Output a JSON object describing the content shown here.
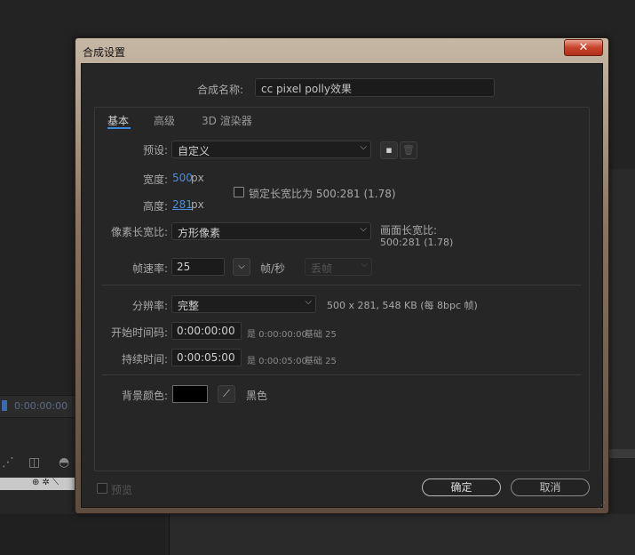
{
  "background": {
    "timecode": "0:00:00:00"
  },
  "dialog": {
    "title": "合成设置",
    "close_label": "✕",
    "name_label": "合成名称:",
    "name_value": "cc pixel polly效果",
    "tabs": [
      {
        "label": "基本",
        "active": true
      },
      {
        "label": "高级",
        "active": false
      },
      {
        "label": "3D 渲染器",
        "active": false
      }
    ],
    "preset": {
      "label": "预设:",
      "value": "自定义"
    },
    "width": {
      "label": "宽度:",
      "value": "500",
      "unit": "px"
    },
    "height": {
      "label": "高度:",
      "value": "281",
      "unit": "px"
    },
    "lock_aspect": {
      "label": "锁定长宽比为 500:281 (1.78)",
      "checked": false
    },
    "pixel_aspect": {
      "label": "像素长宽比:",
      "value": "方形像素"
    },
    "frame_aspect": {
      "label": "画面长宽比:",
      "value": "500:281 (1.78)"
    },
    "frame_rate": {
      "label": "帧速率:",
      "value": "25",
      "unit": "帧/秒",
      "drop_frame": "丢帧"
    },
    "resolution": {
      "label": "分辨率:",
      "value": "完整",
      "info": "500 x 281, 548 KB (每 8bpc 帧)"
    },
    "start_timecode": {
      "label": "开始时间码:",
      "value": "0:00:00:00",
      "info": "是 0:00:00:00",
      "base": "基础 25"
    },
    "duration": {
      "label": "持续时间:",
      "value": "0:00:05:00",
      "info": "是 0:00:05:00",
      "base": "基础 25"
    },
    "bg_color": {
      "label": "背景颜色:",
      "name": "黑色",
      "color": "#000000"
    },
    "preview": {
      "label": "预览",
      "checked": false
    },
    "ok_label": "确定",
    "cancel_label": "取消"
  }
}
